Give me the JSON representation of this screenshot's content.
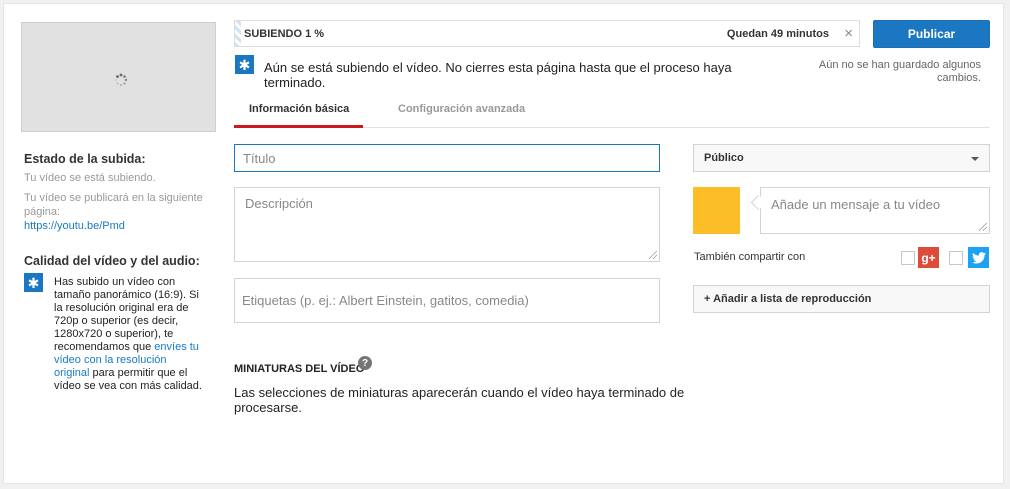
{
  "upload": {
    "progress_label": "SUBIENDO 1 %",
    "progress_percent": 1,
    "time_remaining": "Quedan 49 minutos",
    "notice": "Aún se está subiendo el vídeo. No cierres esta página hasta que el proceso haya terminado.",
    "publish_label": "Publicar",
    "unsaved": "Aún no se han guardado algunos cambios."
  },
  "sidebar": {
    "status_heading": "Estado de la subida:",
    "status_text": "Tu vídeo se está subiendo.",
    "publish_info": "Tu vídeo se publicará en la siguiente página:",
    "video_link": "https://youtu.be/Pmd",
    "quality_heading": "Calidad del vídeo y del audio:",
    "quality_text_before": "Has subido un vídeo con tamaño panorámico (16:9). Si la resolución original era de 720p o superior (es decir, 1280x720 o superior), te recomendamos que ",
    "quality_link": "envíes tu vídeo con la resolución original",
    "quality_text_after": " para permitir que el vídeo se vea con más calidad."
  },
  "tabs": [
    {
      "label": "Información básica",
      "active": true
    },
    {
      "label": "Configuración avanzada",
      "active": false
    }
  ],
  "form": {
    "title_placeholder": "Título",
    "description_placeholder": "Descripción",
    "tags_placeholder": "Etiquetas (p. ej.: Albert Einstein, gatitos, comedia)",
    "privacy_value": "Público",
    "message_placeholder": "Añade un mensaje a tu vídeo",
    "share_label": "También compartir con",
    "gplus_text": "g+",
    "playlist_label": "+ Añadir a lista de reproducción"
  },
  "thumbnails": {
    "heading": "MINIATURAS DEL VÍDEO",
    "help_text": "?",
    "text": "Las selecciones de miniaturas aparecerán cuando el vídeo haya terminado de procesarse."
  },
  "colors": {
    "accent": "#1c77c3",
    "tab_active": "#cc181e",
    "avatar": "#fbbd28",
    "gplus": "#dd4b39",
    "twitter": "#1da1f2"
  }
}
